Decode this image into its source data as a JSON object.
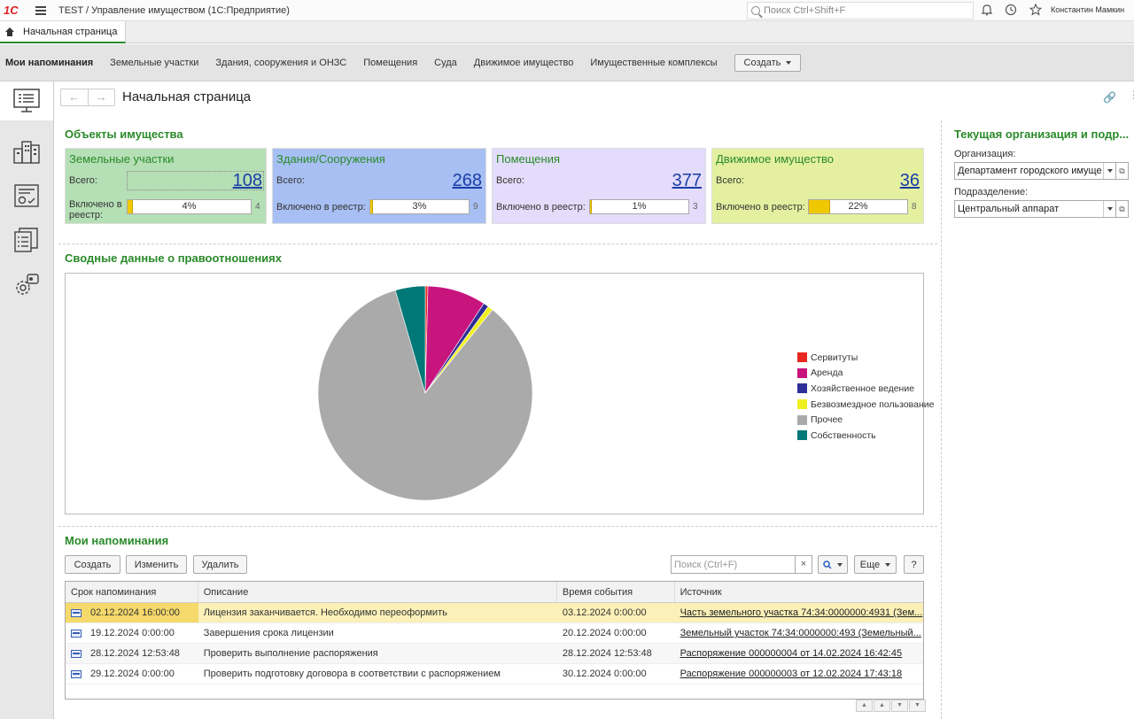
{
  "app": {
    "logo": "1С",
    "title": "TEST / Управление имуществом  (1С:Предприятие)",
    "search_placeholder": "Поиск Ctrl+Shift+F",
    "user": "Константин Мамкин"
  },
  "tabs": {
    "home": "Начальная страница"
  },
  "sections": {
    "items": [
      "Мои напоминания",
      "Земельные участки",
      "Здания, сооружения и ОНЗС",
      "Помещения",
      "Суда",
      "Движимое имущество",
      "Имущественные комплексы"
    ],
    "create": "Создать"
  },
  "page": {
    "title": "Начальная страница"
  },
  "objects": {
    "heading": "Объекты имущества",
    "total_label": "Всего:",
    "registry_label": "Включено в реестр:",
    "registry_label_wrapped": "Включено в реестр:",
    "cards": [
      {
        "title": "Земельные участки",
        "total": "108",
        "pct_label": "4%",
        "pct": 0.04,
        "reg_count": "4",
        "bg": "#b5dfb5"
      },
      {
        "title": "Здания/Сооружения",
        "total": "268",
        "pct_label": "3%",
        "pct": 0.03,
        "reg_count": "9",
        "bg": "#a7bff2"
      },
      {
        "title": "Помещения",
        "total": "377",
        "pct_label": "1%",
        "pct": 0.01,
        "reg_count": "3",
        "bg": "#e3dcfa"
      },
      {
        "title": "Движимое имущество",
        "total": "36",
        "pct_label": "22%",
        "pct": 0.22,
        "reg_count": "8",
        "bg": "#e4f0a0"
      }
    ]
  },
  "relations": {
    "heading": "Сводные данные о правоотношениях"
  },
  "chart_data": {
    "type": "pie",
    "title": "",
    "labels": [
      "Сервитуты",
      "Аренда",
      "Хозяйственное ведение",
      "Безвозмездное пользование",
      "Прочее",
      "Собственность"
    ],
    "values": [
      0.4,
      8.8,
      0.8,
      0.8,
      84.7,
      4.5
    ],
    "colors": [
      "#e8281e",
      "#c8157e",
      "#2e2e96",
      "#f0f020",
      "#aaaaaa",
      "#007878"
    ],
    "legend": "right"
  },
  "reminders": {
    "heading": "Мои напоминания",
    "btn_create": "Создать",
    "btn_edit": "Изменить",
    "btn_delete": "Удалить",
    "search_placeholder": "Поиск (Ctrl+F)",
    "btn_more": "Еще",
    "btn_help": "?",
    "columns": [
      "Срок напоминания",
      "Описание",
      "Время события",
      "Источник"
    ],
    "rows": [
      {
        "due": "02.12.2024 16:00:00",
        "desc": "Лицензия заканчивается. Необходимо переоформить",
        "event": "03.12.2024 0:00:00",
        "source": "Часть земельного участка 74:34:0000000:4931 (Зем..."
      },
      {
        "due": "19.12.2024 0:00:00",
        "desc": "Завершения срока лицензии",
        "event": "20.12.2024 0:00:00",
        "source": "Земельный участок 74:34:0000000:493 (Земельный..."
      },
      {
        "due": "28.12.2024 12:53:48",
        "desc": "Проверить выполнение распоряжения",
        "event": "28.12.2024 12:53:48",
        "source": "Распоряжение 000000004 от 14.02.2024 16:42:45"
      },
      {
        "due": "29.12.2024 0:00:00",
        "desc": "Проверить подготовку договора в соответствии с распоряжением",
        "event": "30.12.2024 0:00:00",
        "source": "Распоряжение 000000003 от 12.02.2024 17:43:18"
      }
    ]
  },
  "org_panel": {
    "heading": "Текущая организация и подр...",
    "org_label": "Организация:",
    "org_value": "Департамент городского имуще",
    "dept_label": "Подразделение:",
    "dept_value": "Центральный аппарат"
  }
}
